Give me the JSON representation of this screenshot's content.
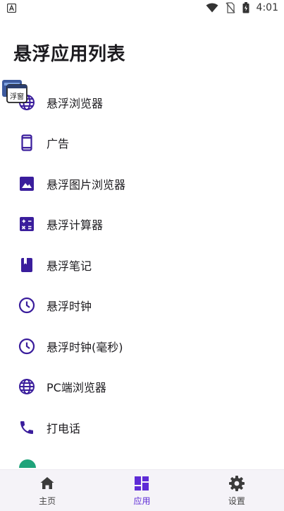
{
  "status_bar": {
    "time": "4:01",
    "icons": [
      "notification-a-icon",
      "wifi-icon",
      "no-sim-icon",
      "battery-icon"
    ]
  },
  "page": {
    "title": "悬浮应用列表"
  },
  "accent_color": "#5e2bd6",
  "apps": [
    {
      "label": "悬浮浏览器",
      "icon": "globe-icon"
    },
    {
      "label": "广告",
      "icon": "phone-frame-icon"
    },
    {
      "label": "悬浮图片浏览器",
      "icon": "image-icon"
    },
    {
      "label": "悬浮计算器",
      "icon": "calculator-icon"
    },
    {
      "label": "悬浮笔记",
      "icon": "notebook-icon"
    },
    {
      "label": "悬浮时钟",
      "icon": "clock-icon"
    },
    {
      "label": "悬浮时钟(毫秒)",
      "icon": "clock-icon"
    },
    {
      "label": "PC端浏览器",
      "icon": "globe-icon"
    },
    {
      "label": "打电话",
      "icon": "phone-icon"
    }
  ],
  "floating_badge": {
    "icon": "floating-window-icon",
    "text": "浮窗"
  },
  "bottom_nav": {
    "items": [
      {
        "label": "主页",
        "icon": "home-icon",
        "active": false
      },
      {
        "label": "应用",
        "icon": "apps-grid-icon",
        "active": true
      },
      {
        "label": "设置",
        "icon": "settings-gear-icon",
        "active": false
      }
    ]
  }
}
